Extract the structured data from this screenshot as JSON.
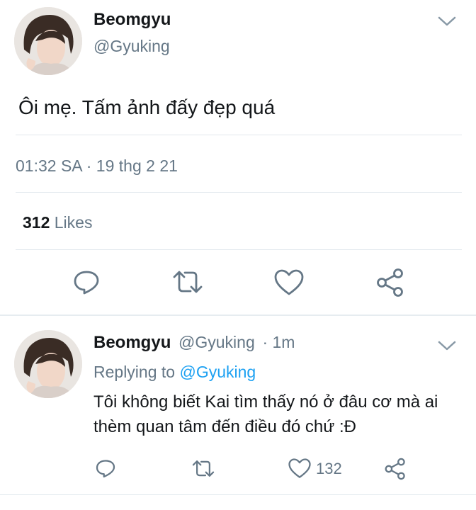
{
  "main_tweet": {
    "author_name": "Beomgyu",
    "author_handle": "@Gyuking",
    "text": "Ôi mẹ. Tấm ảnh đấy đẹp quá",
    "timestamp": "01:32 SA · 19 thg 2 21",
    "likes_count": "312",
    "likes_label": "Likes"
  },
  "reply_tweet": {
    "author_name": "Beomgyu",
    "author_handle": "@Gyuking",
    "time_ago": "· 1m",
    "replying_to_label": "Replying to",
    "replying_to_handle": "@Gyuking",
    "text_line1": "Tôi không biết Kai tìm thấy nó ở đâu cơ mà ai",
    "text_line2": "thèm quan tâm đến điều đó chứ :Đ",
    "like_count": "132"
  },
  "colors": {
    "text": "#14171a",
    "secondary": "#657786",
    "link": "#1da1f2",
    "divider": "#e1e8ed"
  },
  "icons": [
    "chevron-down-icon",
    "reply-icon",
    "retweet-icon",
    "like-icon",
    "share-icon"
  ]
}
